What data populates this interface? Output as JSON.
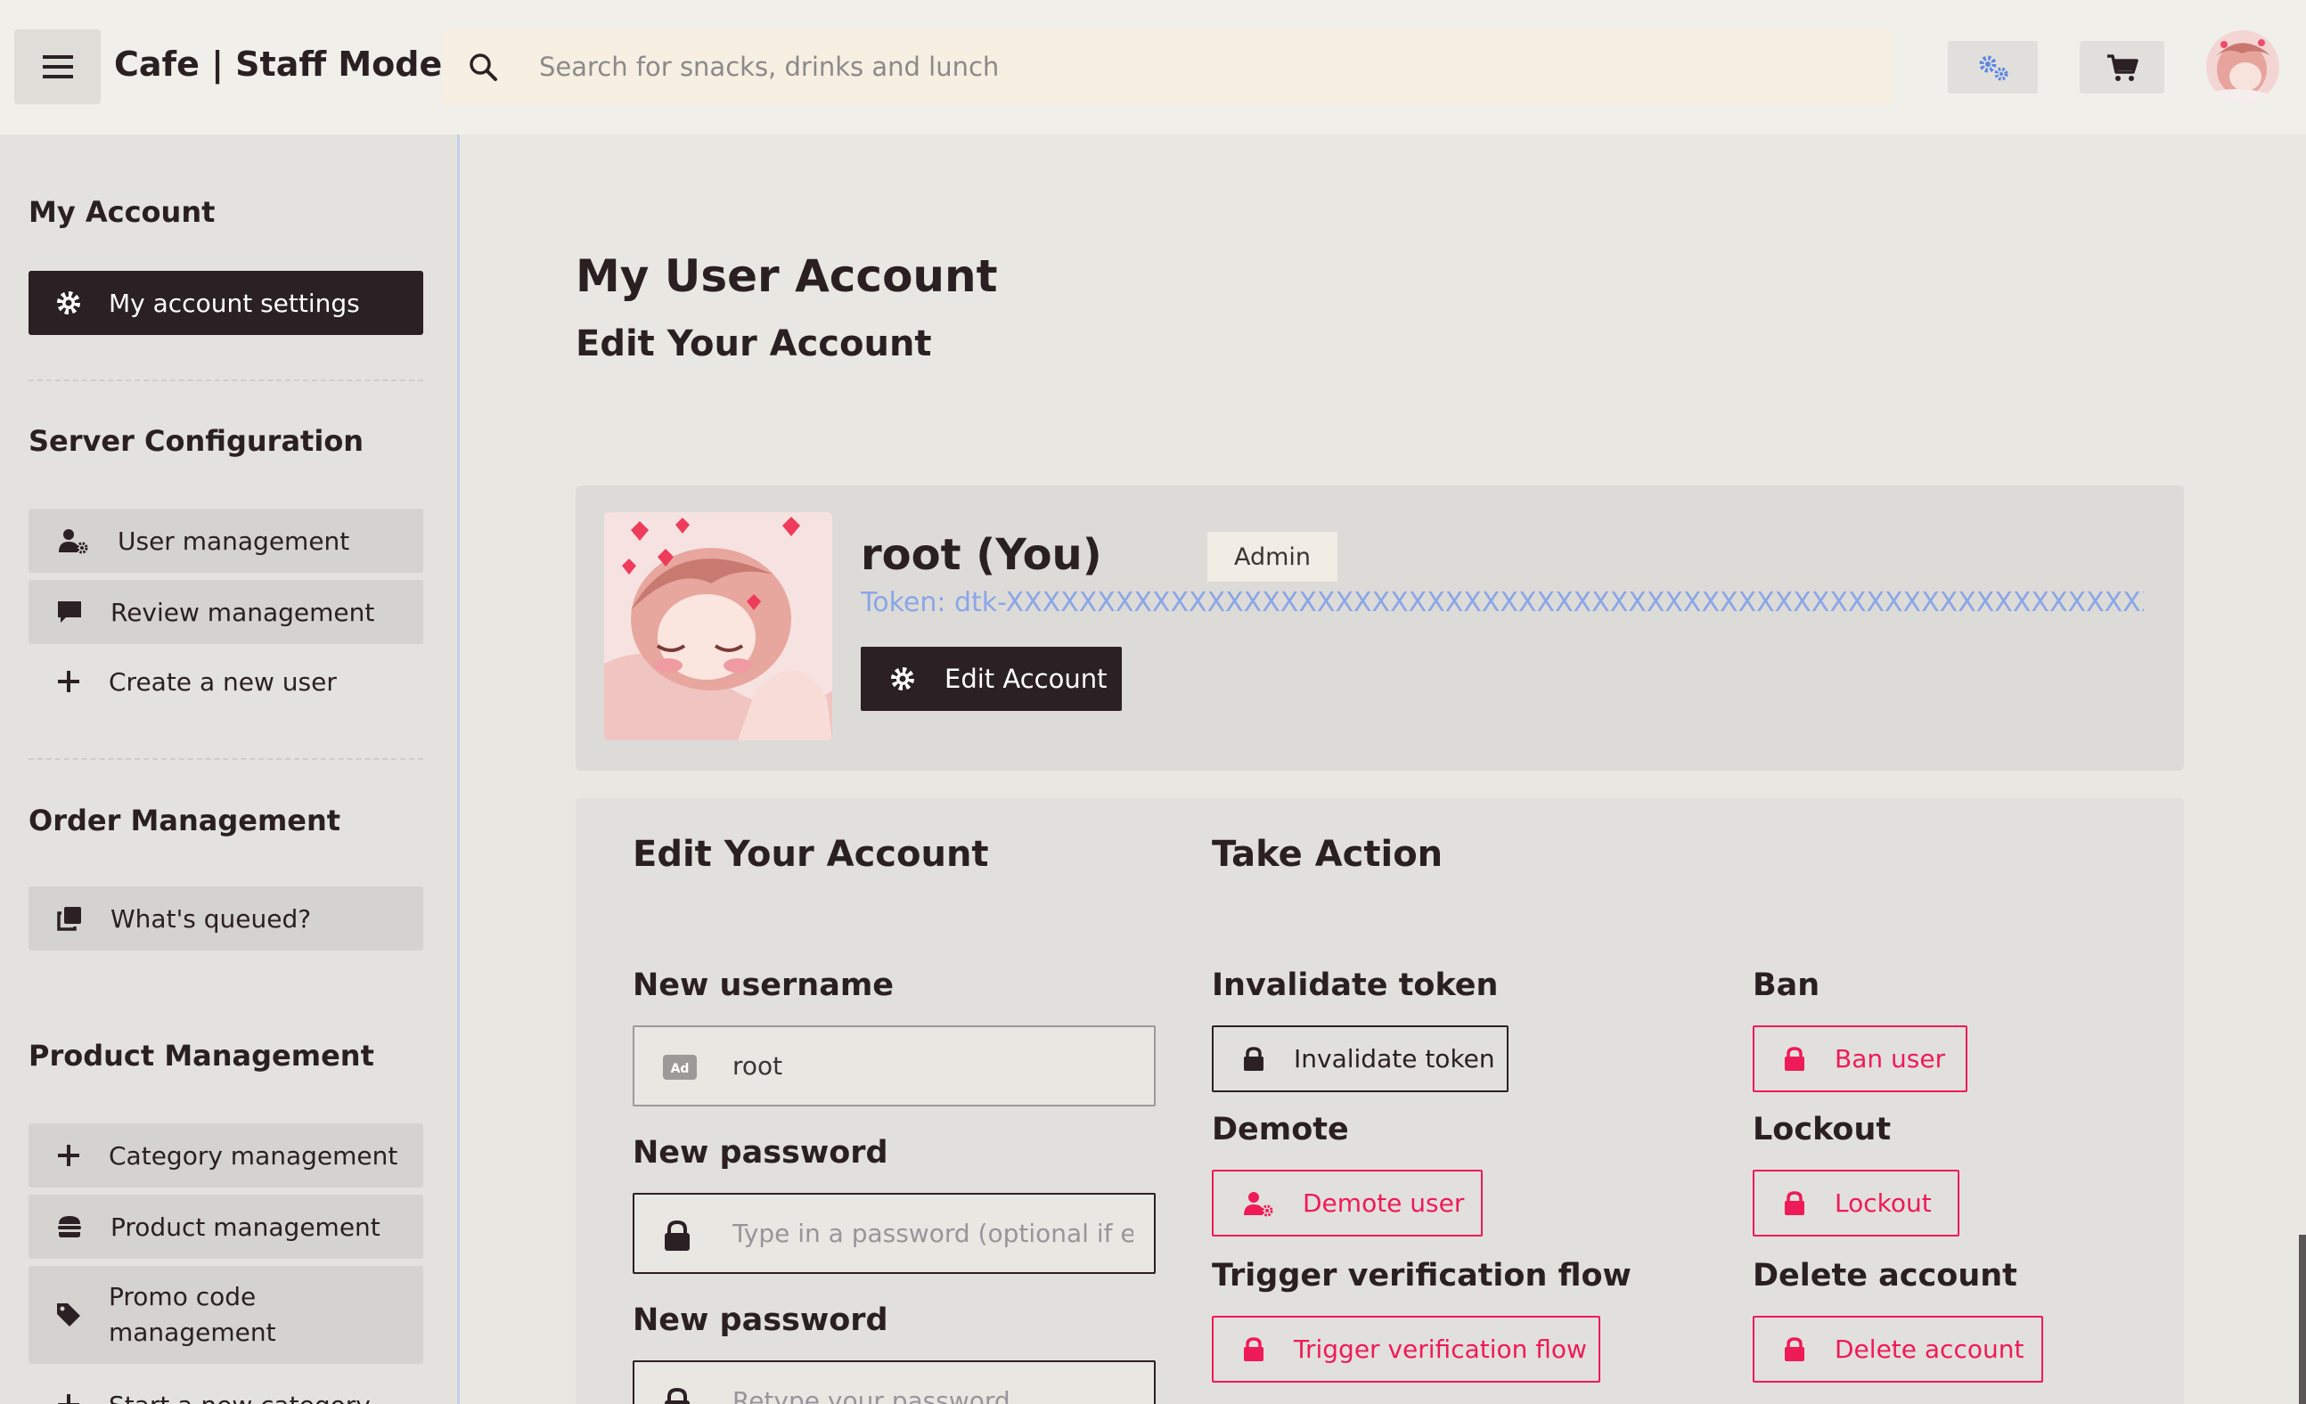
{
  "header": {
    "title": "Cafe | Staff Mode",
    "search_placeholder": "Search for snacks, drinks and lunch"
  },
  "icons": {
    "menu": "hamburger-icon",
    "search": "search-icon",
    "settings": "gears-icon",
    "cart": "cart-icon"
  },
  "colors": {
    "accent_dark": "#2b2024",
    "danger": "#ef1a58",
    "token": "#8aa6e8",
    "gear_blue": "#5b86e5"
  },
  "sidebar": {
    "sections": [
      {
        "heading": "My Account",
        "items": [
          {
            "label": "My account settings",
            "icon": "gear-icon",
            "active": true
          }
        ]
      },
      {
        "heading": "Server Configuration",
        "items": [
          {
            "label": "User management",
            "icon": "user-gear-icon"
          },
          {
            "label": "Review management",
            "icon": "comment-icon"
          },
          {
            "label": "Create a new user",
            "icon": "plus-icon"
          }
        ]
      },
      {
        "heading": "Order Management",
        "items": [
          {
            "label": "What's queued?",
            "icon": "clone-icon"
          }
        ]
      },
      {
        "heading": "Product Management",
        "items": [
          {
            "label": "Category management",
            "icon": "plus-icon"
          },
          {
            "label": "Product management",
            "icon": "burger-icon"
          },
          {
            "label": "Promo code management",
            "label_line1": "Promo code",
            "label_line2": "management",
            "icon": "tag-icon"
          },
          {
            "label": "Start a new category",
            "icon": "plus-icon"
          }
        ]
      }
    ]
  },
  "main": {
    "title": "My User Account",
    "subtitle": "Edit Your Account",
    "profile": {
      "name": "root (You)",
      "role": "Admin",
      "token": "Token: dtk-XXXXXXXXXXXXXXXXXXXXXXXXXXXXXXXXXXXXXXXXXXXXXXXXXXXXXXXXXXXXXXXXXXX",
      "edit_button": "Edit Account"
    },
    "edit_panel": {
      "heading": "Edit Your Account",
      "username_label": "New username",
      "username_value": "root",
      "password_label": "New password",
      "password_placeholder": "Type in a password (optional if empty)",
      "password2_label": "New password",
      "password2_placeholder": "Retype your password"
    },
    "action_panel": {
      "heading": "Take Action",
      "invalidate_label": "Invalidate token",
      "invalidate_button": "Invalidate token",
      "ban_label": "Ban",
      "ban_button": "Ban user",
      "demote_label": "Demote",
      "demote_button": "Demote user",
      "lockout_label": "Lockout",
      "lockout_button": "Lockout",
      "verify_label": "Trigger verification flow",
      "verify_button": "Trigger verification flow",
      "delete_label": "Delete account",
      "delete_button": "Delete account"
    }
  }
}
